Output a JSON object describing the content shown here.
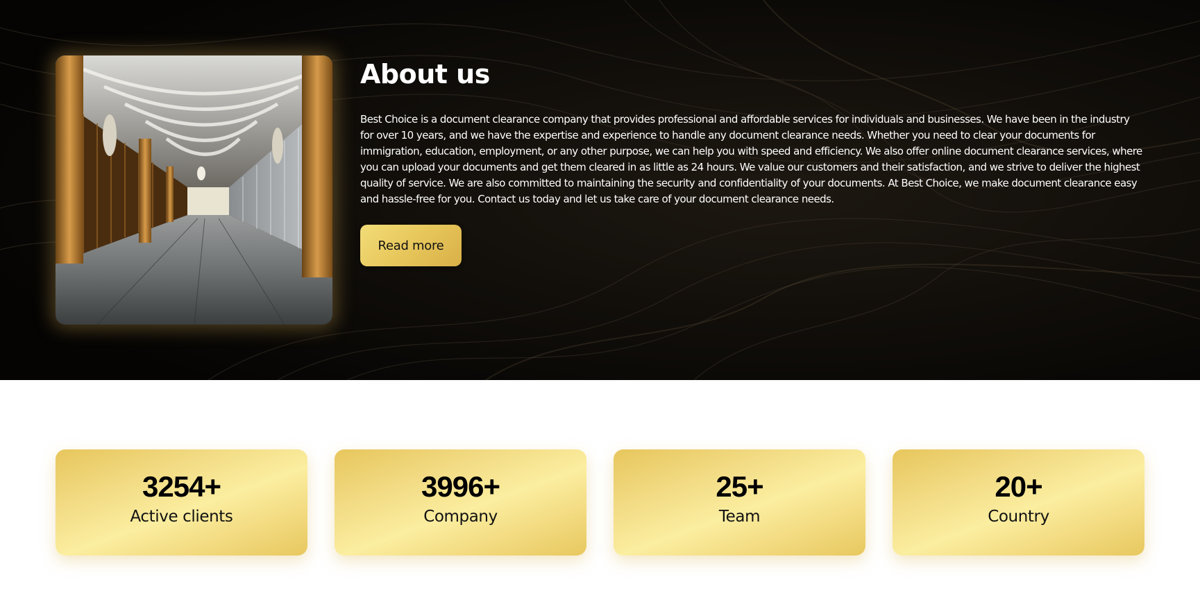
{
  "about": {
    "title": "About us",
    "body": "Best Choice is a document clearance company that provides professional and affordable services for individuals and businesses. We have been in the industry for over 10 years, and we have the expertise and experience to handle any document clearance needs. Whether you need to clear your documents for immigration, education, employment, or any other purpose, we can help you with speed and efficiency. We also offer online document clearance services, where you can upload your documents and get them cleared in as little as 24 hours. We value our customers and their satisfaction, and we strive to deliver the highest quality of service. We are also committed to maintaining the security and confidentiality of your documents. At Best Choice, we make document clearance easy and hassle-free for you. Contact us today and let us take care of your document clearance needs.",
    "read_more_label": "Read more"
  },
  "stats": [
    {
      "number": "3254+",
      "label": "Active clients"
    },
    {
      "number": "3996+",
      "label": "Company"
    },
    {
      "number": "25+",
      "label": "Team"
    },
    {
      "number": "20+",
      "label": "Country"
    }
  ],
  "colors": {
    "gold_light": "#fbeea0",
    "gold_dark": "#e7c65c",
    "hero_background": "#050403",
    "text_light": "#ffffff",
    "text_dark": "#000000"
  }
}
